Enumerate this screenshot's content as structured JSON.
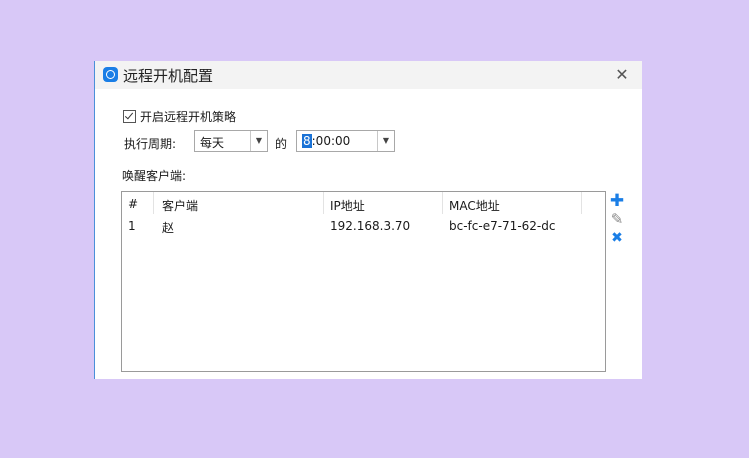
{
  "dialog": {
    "title": "远程开机配置",
    "close_glyph": "✕",
    "enable_label": "开启远程开机策略",
    "period_label": "执行周期:",
    "period_value": "每天",
    "of_label": "的",
    "time_selected": "8",
    "time_rest": ":00:00",
    "clients_label": "唤醒客户端:"
  },
  "table": {
    "columns": [
      "#",
      "客户端",
      "IP地址",
      "MAC地址"
    ],
    "rows": [
      {
        "index": "1",
        "client": "赵",
        "ip": "192.168.3.70",
        "mac": "bc-fc-e7-71-62-dc"
      }
    ]
  },
  "actions": {
    "add_glyph": "✚",
    "edit_glyph": "✎",
    "delete_glyph": "✖"
  },
  "colors": {
    "accent": "#1a7ee6",
    "background": "#d8c8f7"
  }
}
